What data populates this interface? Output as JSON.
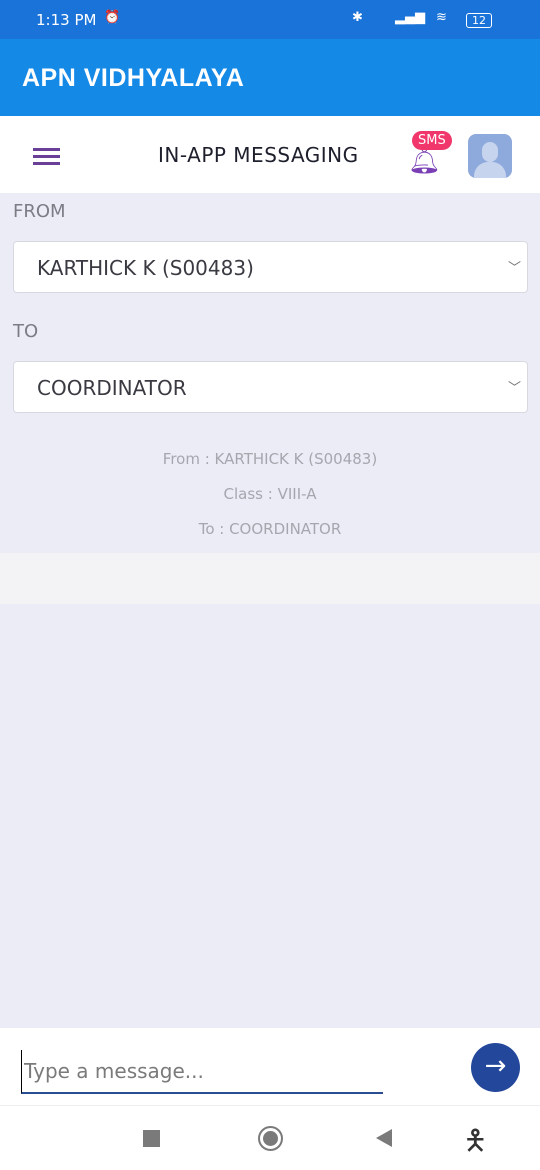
{
  "status_bar": {
    "time": "1:13 PM",
    "battery": "12"
  },
  "app_bar": {
    "title": "APN VIDHYALAYA"
  },
  "header": {
    "title": "IN-APP MESSAGING",
    "badge": "SMS"
  },
  "form": {
    "from_label": "FROM",
    "from_value": "KARTHICK K (S00483)",
    "to_label": "TO",
    "to_value": "COORDINATOR"
  },
  "summary": {
    "from": "From : KARTHICK K (S00483)",
    "class": "Class : VIII-A",
    "to": "To : COORDINATOR"
  },
  "composer": {
    "placeholder": "Type a message..."
  },
  "colors": {
    "app_bar": "#1589e6",
    "status_bar": "#1a73d8",
    "send_button": "#23479a",
    "badge": "#f0366a",
    "content_bg": "#ebecf5"
  }
}
